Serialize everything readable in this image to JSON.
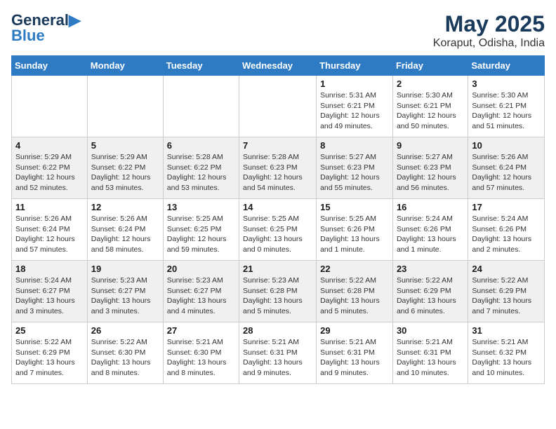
{
  "logo": {
    "line1": "General",
    "line2": "Blue"
  },
  "title": "May 2025",
  "subtitle": "Koraput, Odisha, India",
  "days_of_week": [
    "Sunday",
    "Monday",
    "Tuesday",
    "Wednesday",
    "Thursday",
    "Friday",
    "Saturday"
  ],
  "weeks": [
    [
      {
        "day": "",
        "info": ""
      },
      {
        "day": "",
        "info": ""
      },
      {
        "day": "",
        "info": ""
      },
      {
        "day": "",
        "info": ""
      },
      {
        "day": "1",
        "info": "Sunrise: 5:31 AM\nSunset: 6:21 PM\nDaylight: 12 hours\nand 49 minutes."
      },
      {
        "day": "2",
        "info": "Sunrise: 5:30 AM\nSunset: 6:21 PM\nDaylight: 12 hours\nand 50 minutes."
      },
      {
        "day": "3",
        "info": "Sunrise: 5:30 AM\nSunset: 6:21 PM\nDaylight: 12 hours\nand 51 minutes."
      }
    ],
    [
      {
        "day": "4",
        "info": "Sunrise: 5:29 AM\nSunset: 6:22 PM\nDaylight: 12 hours\nand 52 minutes."
      },
      {
        "day": "5",
        "info": "Sunrise: 5:29 AM\nSunset: 6:22 PM\nDaylight: 12 hours\nand 53 minutes."
      },
      {
        "day": "6",
        "info": "Sunrise: 5:28 AM\nSunset: 6:22 PM\nDaylight: 12 hours\nand 53 minutes."
      },
      {
        "day": "7",
        "info": "Sunrise: 5:28 AM\nSunset: 6:23 PM\nDaylight: 12 hours\nand 54 minutes."
      },
      {
        "day": "8",
        "info": "Sunrise: 5:27 AM\nSunset: 6:23 PM\nDaylight: 12 hours\nand 55 minutes."
      },
      {
        "day": "9",
        "info": "Sunrise: 5:27 AM\nSunset: 6:23 PM\nDaylight: 12 hours\nand 56 minutes."
      },
      {
        "day": "10",
        "info": "Sunrise: 5:26 AM\nSunset: 6:24 PM\nDaylight: 12 hours\nand 57 minutes."
      }
    ],
    [
      {
        "day": "11",
        "info": "Sunrise: 5:26 AM\nSunset: 6:24 PM\nDaylight: 12 hours\nand 57 minutes."
      },
      {
        "day": "12",
        "info": "Sunrise: 5:26 AM\nSunset: 6:24 PM\nDaylight: 12 hours\nand 58 minutes."
      },
      {
        "day": "13",
        "info": "Sunrise: 5:25 AM\nSunset: 6:25 PM\nDaylight: 12 hours\nand 59 minutes."
      },
      {
        "day": "14",
        "info": "Sunrise: 5:25 AM\nSunset: 6:25 PM\nDaylight: 13 hours\nand 0 minutes."
      },
      {
        "day": "15",
        "info": "Sunrise: 5:25 AM\nSunset: 6:26 PM\nDaylight: 13 hours\nand 1 minute."
      },
      {
        "day": "16",
        "info": "Sunrise: 5:24 AM\nSunset: 6:26 PM\nDaylight: 13 hours\nand 1 minute."
      },
      {
        "day": "17",
        "info": "Sunrise: 5:24 AM\nSunset: 6:26 PM\nDaylight: 13 hours\nand 2 minutes."
      }
    ],
    [
      {
        "day": "18",
        "info": "Sunrise: 5:24 AM\nSunset: 6:27 PM\nDaylight: 13 hours\nand 3 minutes."
      },
      {
        "day": "19",
        "info": "Sunrise: 5:23 AM\nSunset: 6:27 PM\nDaylight: 13 hours\nand 3 minutes."
      },
      {
        "day": "20",
        "info": "Sunrise: 5:23 AM\nSunset: 6:27 PM\nDaylight: 13 hours\nand 4 minutes."
      },
      {
        "day": "21",
        "info": "Sunrise: 5:23 AM\nSunset: 6:28 PM\nDaylight: 13 hours\nand 5 minutes."
      },
      {
        "day": "22",
        "info": "Sunrise: 5:22 AM\nSunset: 6:28 PM\nDaylight: 13 hours\nand 5 minutes."
      },
      {
        "day": "23",
        "info": "Sunrise: 5:22 AM\nSunset: 6:29 PM\nDaylight: 13 hours\nand 6 minutes."
      },
      {
        "day": "24",
        "info": "Sunrise: 5:22 AM\nSunset: 6:29 PM\nDaylight: 13 hours\nand 7 minutes."
      }
    ],
    [
      {
        "day": "25",
        "info": "Sunrise: 5:22 AM\nSunset: 6:29 PM\nDaylight: 13 hours\nand 7 minutes."
      },
      {
        "day": "26",
        "info": "Sunrise: 5:22 AM\nSunset: 6:30 PM\nDaylight: 13 hours\nand 8 minutes."
      },
      {
        "day": "27",
        "info": "Sunrise: 5:21 AM\nSunset: 6:30 PM\nDaylight: 13 hours\nand 8 minutes."
      },
      {
        "day": "28",
        "info": "Sunrise: 5:21 AM\nSunset: 6:31 PM\nDaylight: 13 hours\nand 9 minutes."
      },
      {
        "day": "29",
        "info": "Sunrise: 5:21 AM\nSunset: 6:31 PM\nDaylight: 13 hours\nand 9 minutes."
      },
      {
        "day": "30",
        "info": "Sunrise: 5:21 AM\nSunset: 6:31 PM\nDaylight: 13 hours\nand 10 minutes."
      },
      {
        "day": "31",
        "info": "Sunrise: 5:21 AM\nSunset: 6:32 PM\nDaylight: 13 hours\nand 10 minutes."
      }
    ]
  ]
}
